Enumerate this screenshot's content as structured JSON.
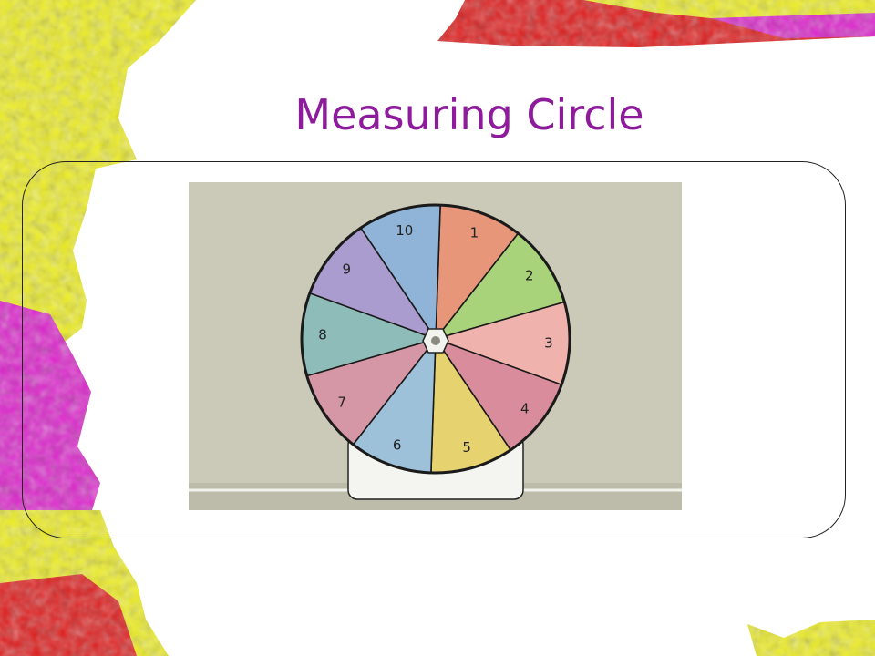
{
  "title": "Measuring Circle",
  "wheel": {
    "segments": [
      {
        "label": "1",
        "color": "#e8967a"
      },
      {
        "label": "2",
        "color": "#a9d37a"
      },
      {
        "label": "3",
        "color": "#efb2ac"
      },
      {
        "label": "4",
        "color": "#d98d9c"
      },
      {
        "label": "5",
        "color": "#e6d36f"
      },
      {
        "label": "6",
        "color": "#9cc1d9"
      },
      {
        "label": "7",
        "color": "#d596a6"
      },
      {
        "label": "8",
        "color": "#8ebcb8"
      },
      {
        "label": "9",
        "color": "#aa9ccf"
      },
      {
        "label": "10",
        "color": "#90b4d8"
      }
    ]
  },
  "colors": {
    "title": "#8e1a9c",
    "decor_yellow": "#eeee22",
    "decor_magenta": "#dd22cc",
    "decor_red": "#e01a1a"
  }
}
